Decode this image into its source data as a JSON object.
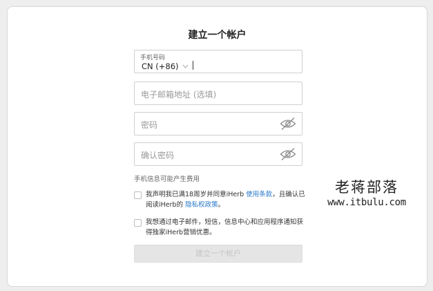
{
  "form": {
    "title": "建立一个帐户",
    "phone": {
      "label": "手机号码",
      "country_code": "CN (+86)",
      "value": ""
    },
    "email": {
      "placeholder": "电子邮箱地址 (选填)"
    },
    "password": {
      "placeholder": "密码",
      "toggle_icon": "eye-slash-icon"
    },
    "confirm_password": {
      "placeholder": "确认密码",
      "toggle_icon": "eye-slash-icon"
    },
    "hint": "手机信息可能产生费用",
    "terms": {
      "text_before": "我声明我已满18周岁并同意iHerb ",
      "terms_link": "使用条款",
      "text_middle": "，且确认已阅读iHerb的 ",
      "privacy_link": "隐私权政策",
      "text_after": "。",
      "checked": false
    },
    "marketing": {
      "text": "我想通过电子邮件，短信，信息中心和应用程序通知获得独家iHerb营销优惠。",
      "checked": false
    },
    "submit_label": "建立一个帐户"
  },
  "watermark": {
    "name": "老蒋部落",
    "url": "www.itbulu.com"
  },
  "colors": {
    "link": "#2878c9",
    "button_disabled_bg": "#e5e5e5",
    "button_disabled_text": "#c5c5c5",
    "border": "#cfcfcf"
  }
}
